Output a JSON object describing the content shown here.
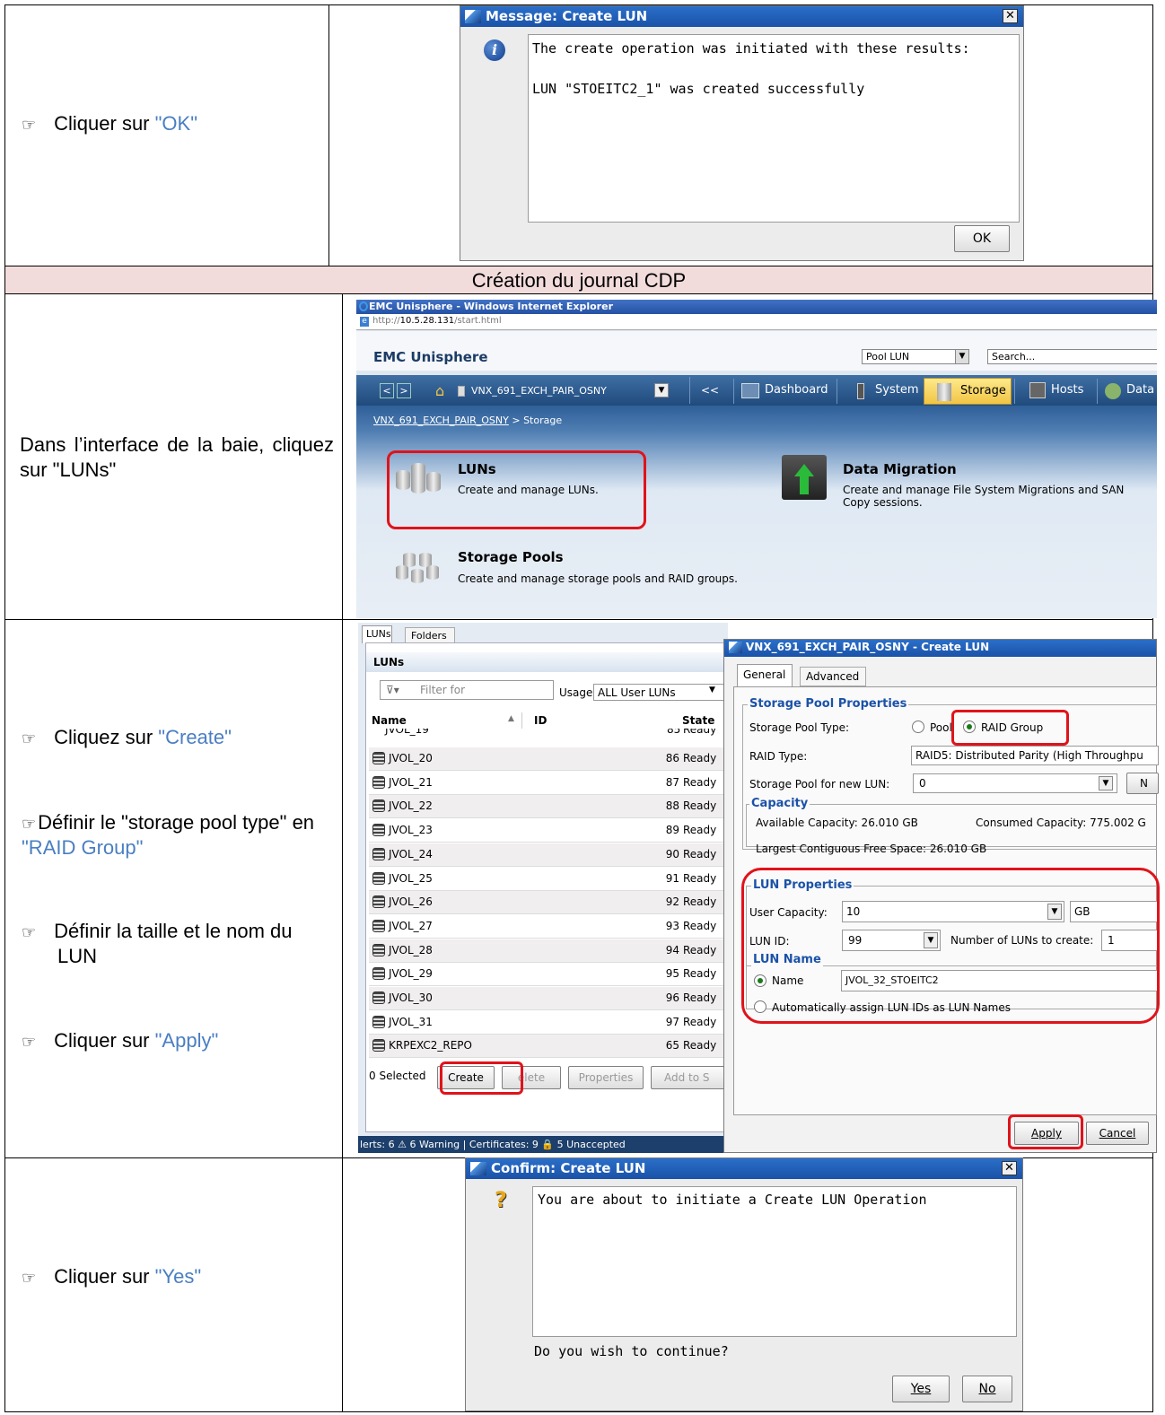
{
  "rows": {
    "r1": {
      "prefix": "Cliquer sur ",
      "link": "\"OK\""
    },
    "section": "Création du journal CDP",
    "r2": {
      "text": "Dans l’interface de la baie, cliquez sur \"LUNs\""
    },
    "r3": {
      "i1_prefix": "Cliquez sur ",
      "i1_link": "\"Create\"",
      "i2_prefix": "Définir le \"storage pool type\" en ",
      "i2_link": "\"RAID Group\"",
      "i3": "Définir la taille et le nom du LUN",
      "i4_prefix": "Cliquer sur ",
      "i4_link": "\"Apply\""
    },
    "r4": {
      "prefix": "Cliquer sur ",
      "link": "\"Yes\""
    }
  },
  "msg": {
    "title": "Message: Create LUN",
    "line1": "The create operation was initiated with these results:",
    "line2": "LUN \"STOEITC2_1\" was created successfully",
    "ok": "OK"
  },
  "browser": {
    "title": "EMC Unisphere - Windows Internet Explorer",
    "url_prefix": "http://",
    "url_host": "10.5.28.131",
    "url_path": "/start.html",
    "app": "EMC Unisphere",
    "pool_select": "Pool LUN",
    "search": "Search...",
    "system_select": "VNX_691_EXCH_PAIR_OSNY",
    "nav": [
      "Dashboard",
      "System",
      "Storage",
      "Hosts",
      "Data"
    ],
    "collapse": "<<",
    "crumb_link": "VNX_691_EXCH_PAIR_OSNY",
    "crumb_rest": " > Storage",
    "luns_title": "LUNs",
    "luns_desc": "Create and manage LUNs.",
    "mig_title": "Data Migration",
    "mig_desc": "Create and manage File System Migrations and SAN Copy sessions.",
    "pools_title": "Storage Pools",
    "pools_desc": "Create and manage storage pools and RAID groups."
  },
  "lunlist": {
    "tabs": [
      "LUNs",
      "Folders"
    ],
    "header": "LUNs",
    "filter": "Filter for",
    "usage_label": "Usage",
    "usage_value": "ALL User LUNs",
    "columns": [
      "Name",
      "ID",
      "State"
    ],
    "partial_row": {
      "name": "JVOL_19",
      "id": "85",
      "state": "Ready"
    },
    "rows": [
      {
        "name": "JVOL_20",
        "id": "86",
        "state": "Ready"
      },
      {
        "name": "JVOL_21",
        "id": "87",
        "state": "Ready"
      },
      {
        "name": "JVOL_22",
        "id": "88",
        "state": "Ready"
      },
      {
        "name": "JVOL_23",
        "id": "89",
        "state": "Ready"
      },
      {
        "name": "JVOL_24",
        "id": "90",
        "state": "Ready"
      },
      {
        "name": "JVOL_25",
        "id": "91",
        "state": "Ready"
      },
      {
        "name": "JVOL_26",
        "id": "92",
        "state": "Ready"
      },
      {
        "name": "JVOL_27",
        "id": "93",
        "state": "Ready"
      },
      {
        "name": "JVOL_28",
        "id": "94",
        "state": "Ready"
      },
      {
        "name": "JVOL_29",
        "id": "95",
        "state": "Ready"
      },
      {
        "name": "JVOL_30",
        "id": "96",
        "state": "Ready"
      },
      {
        "name": "JVOL_31",
        "id": "97",
        "state": "Ready"
      },
      {
        "name": "KRPEXC2_REPO",
        "id": "65",
        "state": "Ready"
      }
    ],
    "selected": "0 Selected",
    "create": "Create",
    "delete": "elete",
    "properties": "Properties",
    "addto": "Add to S",
    "status": "lerts: 6   ⚠ 6 Warning | Certificates: 9   🔒 5 Unaccepted"
  },
  "create": {
    "title": "VNX_691_EXCH_PAIR_OSNY - Create LUN",
    "tabs": [
      "General",
      "Advanced"
    ],
    "spp": "Storage Pool Properties",
    "pool_type_label": "Storage Pool Type:",
    "opt_pool": "Pool",
    "opt_raid": "RAID Group",
    "raid_type_label": "RAID Type:",
    "raid_type_value": "RAID5: Distributed Parity (High Throughpu",
    "pool_new_label": "Storage Pool for new LUN:",
    "pool_new_value": "0",
    "new_btn": "N",
    "capacity": "Capacity",
    "avail": "Available Capacity: 26.010 GB",
    "consumed": "Consumed Capacity: 775.002 G",
    "largest": "Largest Contiguous Free Space: 26.010 GB",
    "lunprops": "LUN Properties",
    "user_cap_label": "User Capacity:",
    "user_cap_value": "10",
    "unit": "GB",
    "lunid_label": "LUN ID:",
    "lunid_value": "99",
    "num_label": "Number of LUNs to create:",
    "num_value": "1",
    "lunname": "LUN Name",
    "name_opt": "Name",
    "name_value": "JVOL_32_STOEITC2",
    "auto": "Automatically assign LUN IDs as LUN Names",
    "apply": "Apply",
    "cancel": "Cancel"
  },
  "confirm": {
    "title": "Confirm: Create LUN",
    "msg": "You are about to initiate a Create LUN Operation",
    "question": "Do you wish to continue?",
    "yes": "Yes",
    "no": "No"
  },
  "colors": {
    "link": "#4a7ec2",
    "section_bg": "#f2dcdb",
    "highlight": "#e0131b",
    "title_blue": "#1b52a8"
  }
}
